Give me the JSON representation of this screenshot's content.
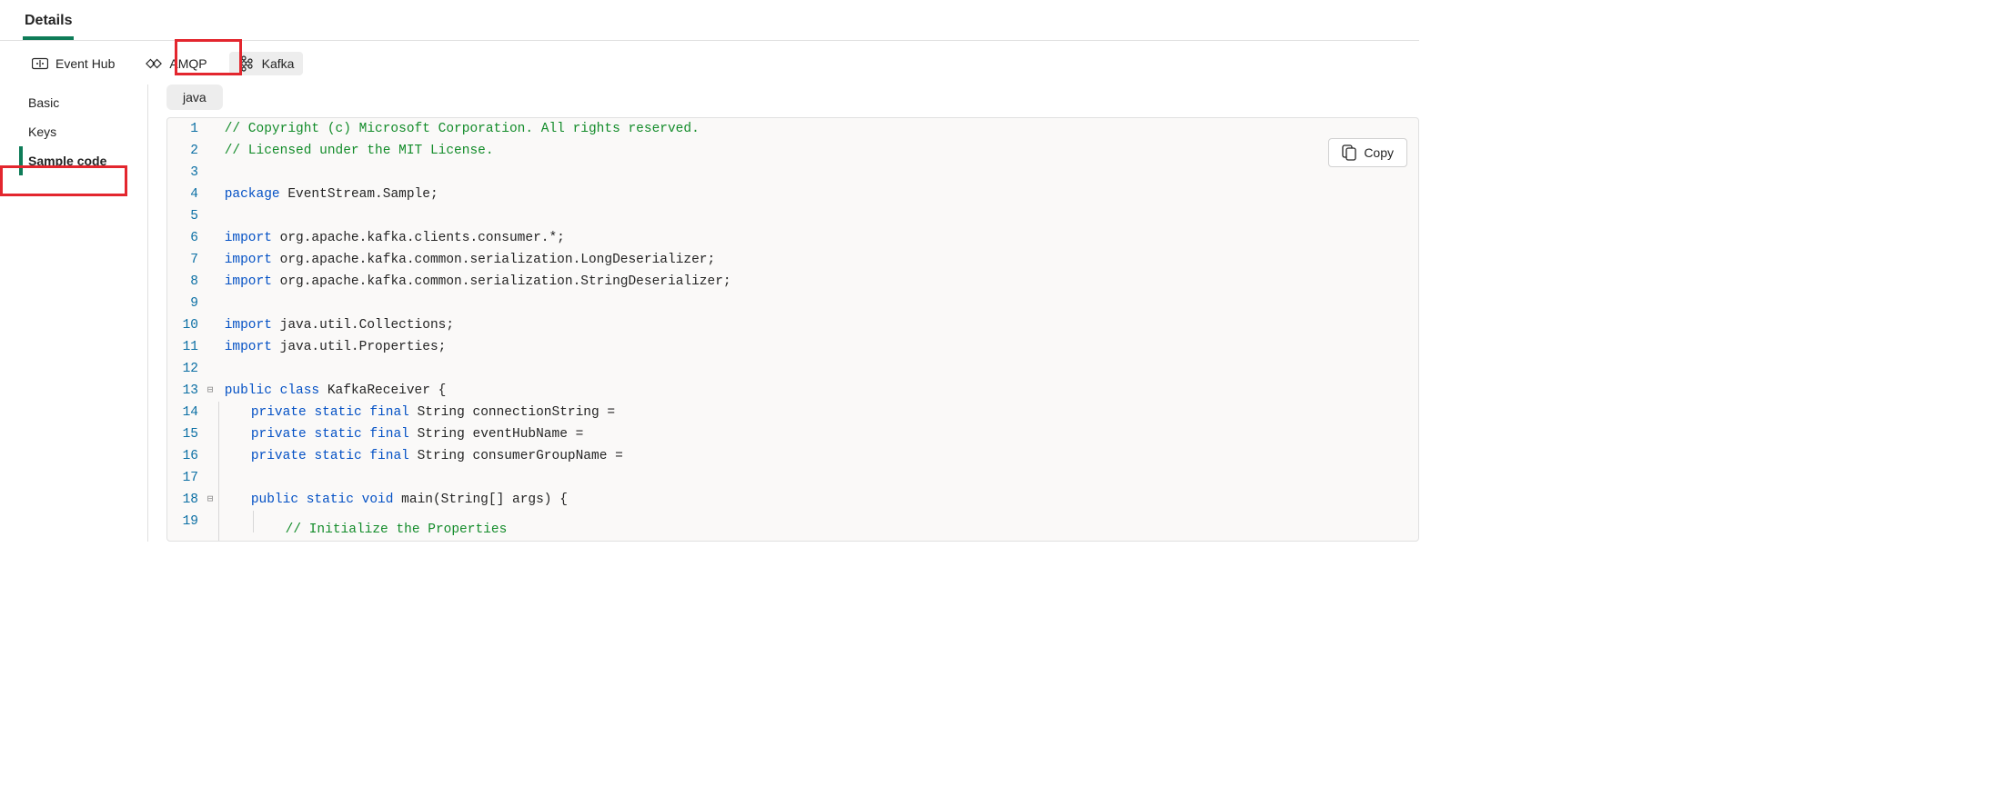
{
  "top_tab": "Details",
  "protocols": {
    "eventhub": "Event Hub",
    "amqp": "AMQP",
    "kafka": "Kafka"
  },
  "sidebar": {
    "basic": "Basic",
    "keys": "Keys",
    "sample_code": "Sample code"
  },
  "language_pill": "java",
  "copy_btn": "Copy",
  "code": {
    "l1": "// Copyright (c) Microsoft Corporation. All rights reserved.",
    "l2": "// Licensed under the MIT License.",
    "l3": "",
    "l4_kw": "package",
    "l4_rest": " EventStream.Sample;",
    "l5": "",
    "l6_kw": "import",
    "l6_rest": " org.apache.kafka.clients.consumer.*;",
    "l7_kw": "import",
    "l7_rest": " org.apache.kafka.common.serialization.LongDeserializer;",
    "l8_kw": "import",
    "l8_rest": " org.apache.kafka.common.serialization.StringDeserializer;",
    "l9": "",
    "l10_kw": "import",
    "l10_rest": " java.util.Collections;",
    "l11_kw": "import",
    "l11_rest": " java.util.Properties;",
    "l12": "",
    "l13_kw1": "public",
    "l13_kw2": "class",
    "l13_rest": " KafkaReceiver {",
    "l14_kw1": "private",
    "l14_kw2": "static",
    "l14_kw3": "final",
    "l14_rest": " String connectionString =",
    "l15_kw1": "private",
    "l15_kw2": "static",
    "l15_kw3": "final",
    "l15_rest": " String eventHubName =",
    "l16_kw1": "private",
    "l16_kw2": "static",
    "l16_kw3": "final",
    "l16_rest": " String consumerGroupName =",
    "l17": "",
    "l18_kw1": "public",
    "l18_kw2": "static",
    "l18_kw3": "void",
    "l18_rest": " main(String[] args) {",
    "l19_cm": "// Initialize the Properties"
  }
}
